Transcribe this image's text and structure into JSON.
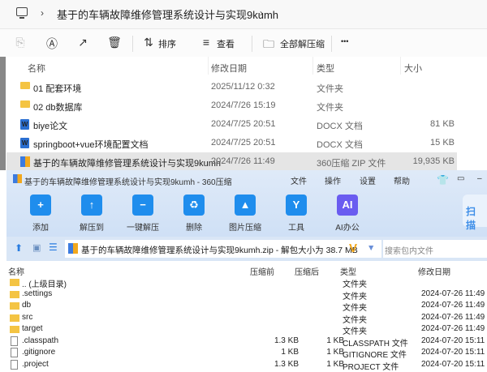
{
  "explorer": {
    "breadcrumb": "基于的车辆故障维修管理系统设计与实现9kumh",
    "toolbar": {
      "sort": "排序",
      "view": "查看",
      "extract_all": "全部解压缩",
      "more": "•••"
    },
    "columns": {
      "name": "名称",
      "date": "修改日期",
      "type": "类型",
      "size": "大小"
    },
    "rows": [
      {
        "name": "01 配套环境",
        "date": "2025/11/12 0:32",
        "type": "文件夹",
        "size": "",
        "icon": "folder"
      },
      {
        "name": "02 db数据库",
        "date": "2024/7/26 15:19",
        "type": "文件夹",
        "size": "",
        "icon": "folder"
      },
      {
        "name": "biye论文",
        "date": "2024/7/25 20:51",
        "type": "DOCX 文档",
        "size": "81 KB",
        "icon": "docx"
      },
      {
        "name": "springboot+vue环境配置文档",
        "date": "2024/7/25 20:51",
        "type": "DOCX 文档",
        "size": "15 KB",
        "icon": "docx"
      },
      {
        "name": "基于的车辆故障维修管理系统设计与实现9kumh",
        "date": "2024/7/26 11:49",
        "type": "360压缩 ZIP 文件",
        "size": "19,935 KB",
        "icon": "zip",
        "selected": true
      }
    ]
  },
  "zip": {
    "title": "基于的车辆故障维修管理系统设计与实现9kumh - 360压缩",
    "menu": [
      "文件",
      "操作",
      "设置",
      "帮助"
    ],
    "tools": [
      {
        "label": "添加",
        "glyph": "+",
        "color": "#1f8ded"
      },
      {
        "label": "解压到",
        "glyph": "↑",
        "color": "#1f8ded"
      },
      {
        "label": "一键解压",
        "glyph": "−",
        "color": "#1f8ded"
      },
      {
        "label": "删除",
        "glyph": "♻",
        "color": "#1f8ded"
      },
      {
        "label": "图片压缩",
        "glyph": "▲",
        "color": "#1f8ded"
      },
      {
        "label": "工具",
        "glyph": "Y",
        "color": "#1f8ded"
      },
      {
        "label": "AI办公",
        "glyph": "AI",
        "color": "#6a5cf0"
      }
    ],
    "scan": "扫描",
    "path": "基于的车辆故障维修管理系统设计与实现9kumh.zip - 解包大小为 38.7 MB",
    "search_placeholder": "搜索包内文件",
    "columns": {
      "name": "名称",
      "before": "压缩前",
      "after": "压缩后",
      "type": "类型",
      "date": "修改日期"
    },
    "rows": [
      {
        "name": ".. (上级目录)",
        "before": "",
        "after": "",
        "type": "文件夹",
        "date": "",
        "icon": "folder"
      },
      {
        "name": ".settings",
        "before": "",
        "after": "",
        "type": "文件夹",
        "date": "2024-07-26 11:49",
        "icon": "folder"
      },
      {
        "name": "db",
        "before": "",
        "after": "",
        "type": "文件夹",
        "date": "2024-07-26 11:49",
        "icon": "folder"
      },
      {
        "name": "src",
        "before": "",
        "after": "",
        "type": "文件夹",
        "date": "2024-07-26 11:49",
        "icon": "folder"
      },
      {
        "name": "target",
        "before": "",
        "after": "",
        "type": "文件夹",
        "date": "2024-07-26 11:49",
        "icon": "folder"
      },
      {
        "name": ".classpath",
        "before": "1.3 KB",
        "after": "1 KB",
        "type": "CLASSPATH 文件",
        "date": "2024-07-20 15:11",
        "icon": "file"
      },
      {
        "name": ".gitignore",
        "before": "1 KB",
        "after": "1 KB",
        "type": "GITIGNORE 文件",
        "date": "2024-07-20 15:11",
        "icon": "file"
      },
      {
        "name": ".project",
        "before": "1.3 KB",
        "after": "1 KB",
        "type": "PROJECT 文件",
        "date": "2024-07-20 15:11",
        "icon": "file"
      }
    ]
  }
}
